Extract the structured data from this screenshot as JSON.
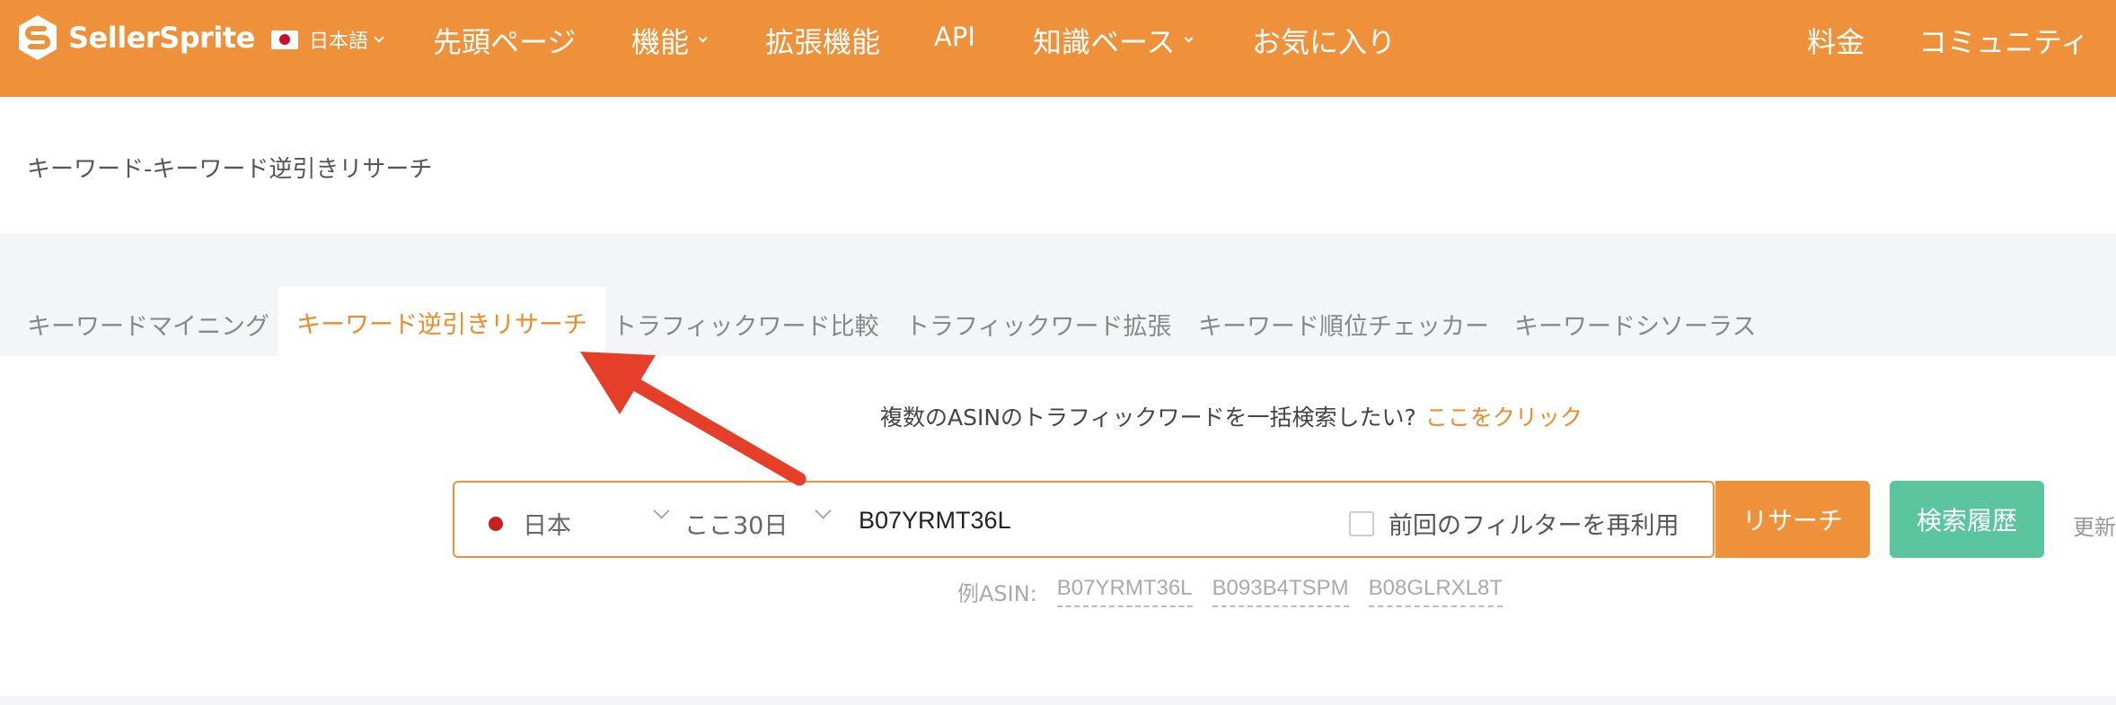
{
  "header": {
    "brand": "SellerSprite",
    "language": "日本語",
    "nav": [
      "先頭ページ",
      "機能",
      "拡張機能",
      "API",
      "知識ベース",
      "お気に入り"
    ],
    "right_nav": [
      "料金",
      "コミュニティ"
    ],
    "bg_color": "#ee913a"
  },
  "page": {
    "title": "キーワード-キーワード逆引きリサーチ"
  },
  "tabs": [
    "キーワードマイニング",
    "キーワード逆引きリサーチ",
    "トラフィックワード比較",
    "トラフィックワード拡張",
    "キーワード順位チェッカー",
    "キーワードシソーラス"
  ],
  "active_tab": 1,
  "bulk": {
    "text": "複数のASINのトラフィックワードを一括検索したい?",
    "link": "ここをクリック"
  },
  "search": {
    "marketplace": "日本",
    "period": "ここ30日",
    "asin_value": "B07YRMT36L",
    "reuse_filter_label": "前回のフィルターを再利用",
    "search_button": "リサーチ",
    "history_button": "検索履歴",
    "update_text": "更新"
  },
  "examples": {
    "label": "例ASIN:",
    "asins": [
      "B07YRMT36L",
      "B093B4TSPM",
      "B08GLRXL8T"
    ]
  },
  "colors": {
    "accent": "#ee913a",
    "active_tab": "#ee8a2a",
    "history": "#5bc5a0",
    "arrow": "#e53f2a"
  }
}
